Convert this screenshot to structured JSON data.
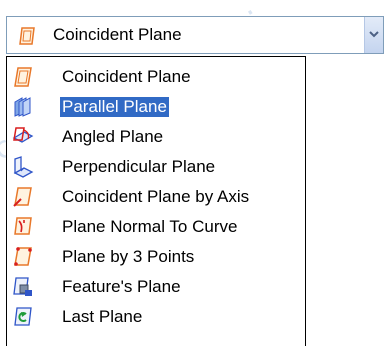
{
  "combobox": {
    "selected_label": "Coincident Plane",
    "selected_icon": "coincident-plane-icon"
  },
  "dropdown": {
    "selected_index": 1,
    "items": [
      {
        "label": "Coincident Plane",
        "icon": "coincident-plane-icon"
      },
      {
        "label": "Parallel Plane",
        "icon": "parallel-plane-icon"
      },
      {
        "label": "Angled Plane",
        "icon": "angled-plane-icon"
      },
      {
        "label": "Perpendicular Plane",
        "icon": "perpendicular-plane-icon"
      },
      {
        "label": "Coincident Plane by Axis",
        "icon": "plane-by-axis-icon"
      },
      {
        "label": "Plane Normal To Curve",
        "icon": "plane-normal-to-curve-icon"
      },
      {
        "label": "Plane by 3 Points",
        "icon": "plane-by-3-points-icon"
      },
      {
        "label": "Feature's Plane",
        "icon": "features-plane-icon"
      },
      {
        "label": "Last Plane",
        "icon": "last-plane-icon"
      }
    ]
  },
  "colors": {
    "highlight": "#316ac5",
    "plane_orange": "#e8782a",
    "plane_red": "#d81e1e",
    "plane_blue": "#2f55c8",
    "combo_border": "#7f9db9"
  }
}
